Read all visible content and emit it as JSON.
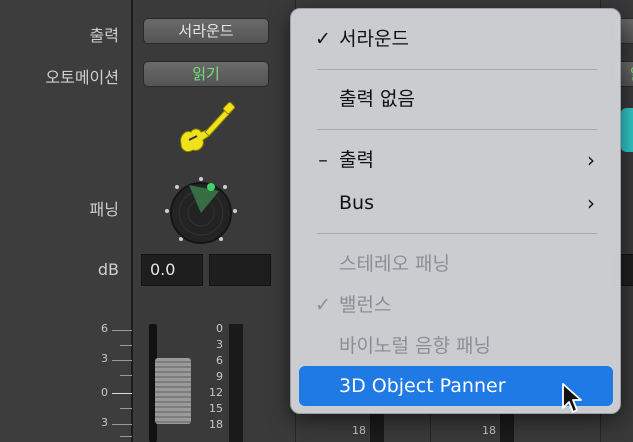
{
  "labels": {
    "output": "출력",
    "automation": "오토메이션",
    "panning": "패닝",
    "db": "dB"
  },
  "strip": {
    "output_button": "서라운드",
    "automation_button": "읽기",
    "db_value": "0.0",
    "fader_scale": [
      "6",
      "3",
      "0",
      "3",
      "6"
    ],
    "meter_scale": [
      "0",
      "3",
      "6",
      "9",
      "12",
      "15",
      "18"
    ],
    "right_meter_scale": [
      "15",
      "18"
    ],
    "right_edge_partial": "읽"
  },
  "menu": {
    "items": [
      {
        "label": "서라운드",
        "mark": "✓",
        "disabled": false
      },
      {
        "label": "출력 없음",
        "mark": "",
        "disabled": false
      },
      {
        "label": "출력",
        "mark": "–",
        "disabled": false,
        "submenu": true
      },
      {
        "label": "Bus",
        "mark": "",
        "disabled": false,
        "submenu": true
      },
      {
        "label": "스테레오 패닝",
        "mark": "",
        "disabled": true
      },
      {
        "label": "밸런스",
        "mark": "✓",
        "disabled": true
      },
      {
        "label": "바이노럴 음향 패닝",
        "mark": "",
        "disabled": true
      },
      {
        "label": "3D Object Panner",
        "mark": "",
        "disabled": false,
        "highlighted": true
      }
    ],
    "submenu_arrow": "›"
  },
  "colors": {
    "accent": "#1f7ae6",
    "automation_text": "#74e07a",
    "guitar_icon": "#f0e21a",
    "panner_dot": "#3fd36a"
  },
  "icons": {
    "instrument": "electric-guitar-icon",
    "cursor": "arrow-cursor-icon"
  }
}
